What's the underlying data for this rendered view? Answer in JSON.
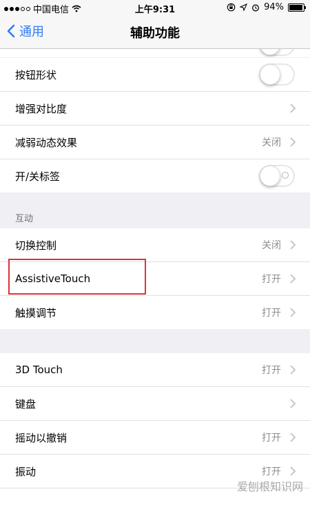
{
  "status_bar": {
    "carrier": "中国电信",
    "time": "上午9:31",
    "battery": "94%",
    "battery_level": 0.94
  },
  "nav": {
    "back_label": "通用",
    "title": "辅助功能"
  },
  "group1": [
    {
      "label": "按钮形状",
      "kind": "toggle",
      "on": false
    },
    {
      "label": "增强对比度",
      "kind": "chevron"
    },
    {
      "label": "减弱动态效果",
      "kind": "chevron",
      "value": "关闭"
    },
    {
      "label": "开/关标签",
      "kind": "toggle",
      "on": false
    }
  ],
  "section_interaction": "互动",
  "group2": [
    {
      "label": "切换控制",
      "value": "关闭"
    },
    {
      "label": "AssistiveTouch",
      "value": "打开"
    },
    {
      "label": "触摸调节",
      "value": "打开"
    }
  ],
  "group3": [
    {
      "label": "3D Touch",
      "value": "打开"
    },
    {
      "label": "键盘",
      "value": ""
    },
    {
      "label": "摇动以撤销",
      "value": "打开"
    },
    {
      "label": "振动",
      "value": "打开"
    }
  ],
  "watermark": "爱刨根知识网",
  "colors": {
    "accent": "#2f7cf6",
    "highlight": "#d9343b"
  },
  "icons": [
    "signal-dots-icon",
    "wifi-icon",
    "lock-rotation-icon",
    "location-icon",
    "alarm-icon",
    "battery-icon",
    "back-chevron-icon",
    "chevron-right-icon"
  ]
}
